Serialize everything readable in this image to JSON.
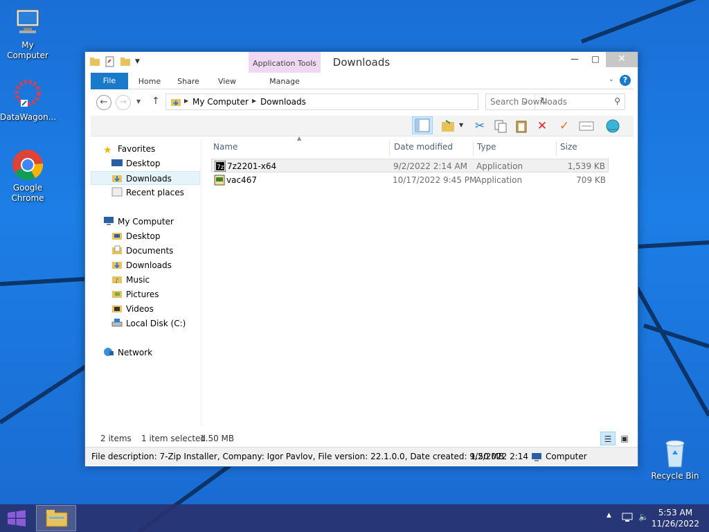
{
  "desktop": {
    "icons": [
      {
        "label": "My Computer"
      },
      {
        "label": "DataWagon..."
      },
      {
        "label": "Google Chrome"
      },
      {
        "label": "Recycle Bin"
      }
    ]
  },
  "window": {
    "title": "Downloads",
    "context_tab": "Application Tools",
    "tabs": [
      "File",
      "Home",
      "Share",
      "View",
      "Manage"
    ],
    "address": {
      "crumbs": [
        "My Computer",
        "Downloads"
      ]
    },
    "search": {
      "placeholder": "Search Downloads"
    },
    "nav": {
      "favorites": {
        "label": "Favorites",
        "items": [
          "Desktop",
          "Downloads",
          "Recent places"
        ]
      },
      "computer": {
        "label": "My Computer",
        "items": [
          "Desktop",
          "Documents",
          "Downloads",
          "Music",
          "Pictures",
          "Videos",
          "Local Disk (C:)"
        ]
      },
      "network": {
        "label": "Network"
      }
    },
    "columns": [
      "Name",
      "Date modified",
      "Type",
      "Size"
    ],
    "files": [
      {
        "name": "7z2201-x64",
        "date": "9/2/2022 2:14 AM",
        "type": "Application",
        "size": "1,539 KB"
      },
      {
        "name": "vac467",
        "date": "10/17/2022 9:45 PM",
        "type": "Application",
        "size": "709 KB"
      }
    ],
    "status": {
      "items": "2 items",
      "selected": "1 item selected",
      "size": "1.50 MB"
    },
    "details": {
      "description": "File description: 7-Zip Installer, Company: Igor Pavlov, File version: 22.1.0.0, Date created: 9/2/2022 2:14",
      "size": "1.50 MB",
      "location": "Computer"
    }
  },
  "taskbar": {
    "time": "5:53 AM",
    "date": "11/26/2022"
  }
}
